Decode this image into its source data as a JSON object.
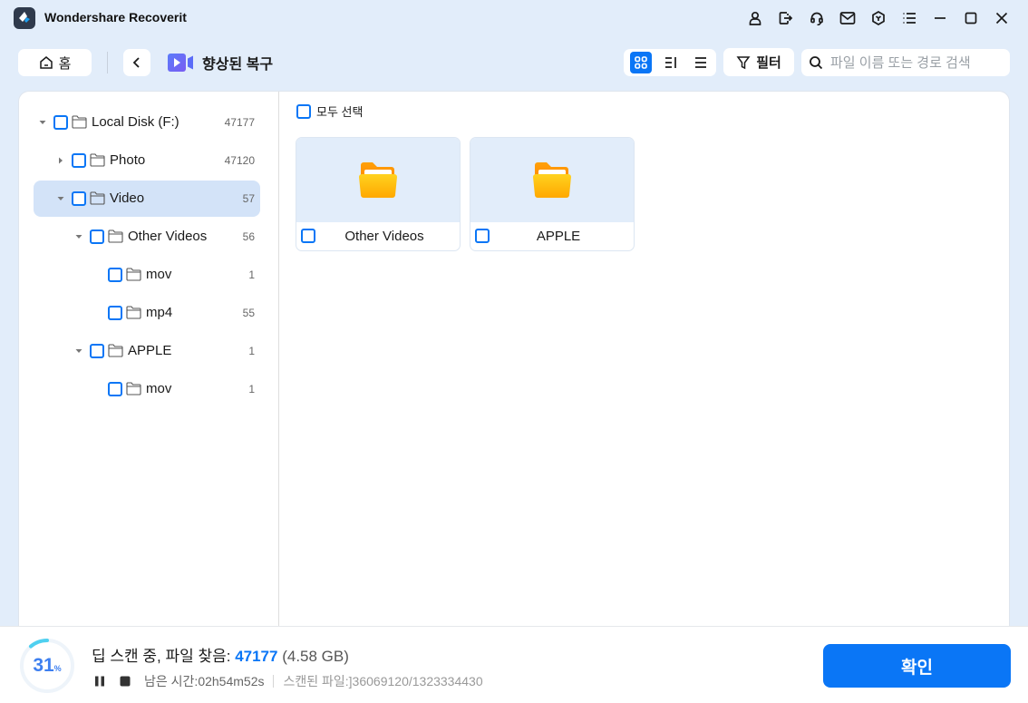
{
  "app": {
    "title": "Wondershare Recoverit"
  },
  "window_controls": [
    {
      "name": "account-icon"
    },
    {
      "name": "sign-out-icon"
    },
    {
      "name": "headset-support-icon"
    },
    {
      "name": "mail-icon"
    },
    {
      "name": "cube-icon"
    },
    {
      "name": "menu-list-icon"
    },
    {
      "name": "minimize-icon"
    },
    {
      "name": "maximize-icon"
    },
    {
      "name": "close-icon"
    }
  ],
  "toolbar": {
    "home_label": "홈",
    "breadcrumb_title": "향상된 복구",
    "filter_label": "필터",
    "search_placeholder": "파일 이름 또는 경로 검색",
    "search_value": "",
    "active_view": "grid"
  },
  "tree": [
    {
      "name": "Local Disk (F:)",
      "count": "47177",
      "level": 0,
      "expander": "expanded",
      "selected": false
    },
    {
      "name": "Photo",
      "count": "47120",
      "level": 1,
      "expander": "collapsed",
      "selected": false
    },
    {
      "name": "Video",
      "count": "57",
      "level": 1,
      "expander": "expanded",
      "selected": true
    },
    {
      "name": "Other Videos",
      "count": "56",
      "level": 2,
      "expander": "expanded",
      "selected": false
    },
    {
      "name": "mov",
      "count": "1",
      "level": 3,
      "expander": "none",
      "selected": false
    },
    {
      "name": "mp4",
      "count": "55",
      "level": 3,
      "expander": "none",
      "selected": false
    },
    {
      "name": "APPLE",
      "count": "1",
      "level": 2,
      "expander": "expanded",
      "selected": false
    },
    {
      "name": "mov",
      "count": "1",
      "level": 3,
      "expander": "none",
      "selected": false
    }
  ],
  "content": {
    "select_all_label": "모두 선택",
    "items": [
      {
        "name": "Other Videos",
        "type": "folder"
      },
      {
        "name": "APPLE",
        "type": "folder"
      }
    ]
  },
  "scan": {
    "progress_percent": 31,
    "progress_label": "31",
    "percent_sign": "%",
    "status_prefix": "딥 스캔 중, 파일 찾음: ",
    "files_found": "47177",
    "size": "(4.58 GB)",
    "time_left_label": "남은 시간: ",
    "time_left": "02h54m52s",
    "scanned_label": "스캔된 파일:",
    "scanned_value": "]36069120/1323334430",
    "confirm_label": "확인"
  },
  "colors": {
    "accent": "#0a76f6",
    "background": "#e2edfa",
    "selected_row": "#d3e3f8",
    "progress_arc": "#4fd0f0",
    "folder": "#ffb300"
  }
}
